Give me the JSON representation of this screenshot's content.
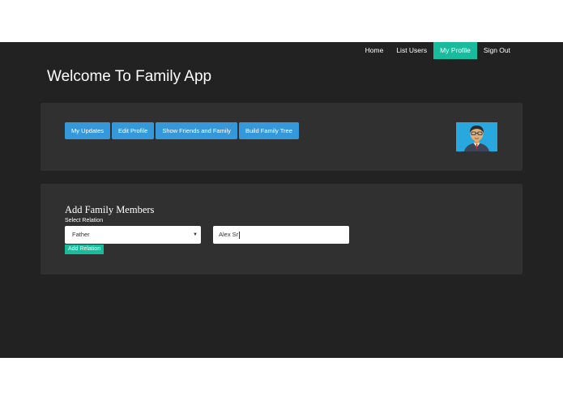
{
  "navbar": {
    "items": [
      {
        "label": "Home",
        "active": false
      },
      {
        "label": "List Users",
        "active": false
      },
      {
        "label": "My Profile",
        "active": true
      },
      {
        "label": "Sign Out",
        "active": false
      }
    ]
  },
  "page_title": "Welcome To Family App",
  "profile_panel": {
    "buttons": [
      {
        "label": "My Updates"
      },
      {
        "label": "Edit Profile"
      },
      {
        "label": "Show Friends and Family"
      },
      {
        "label": "Build Family Tree"
      }
    ]
  },
  "add_family": {
    "title": "Add Family Members",
    "relation_label": "Select Relation",
    "relation_value": "Father",
    "name_value": "Alex Sr",
    "submit_label": "Add Relation"
  },
  "colors": {
    "background": "#222222",
    "panel": "#303030",
    "primary": "#3498db",
    "success": "#18bc9c"
  }
}
